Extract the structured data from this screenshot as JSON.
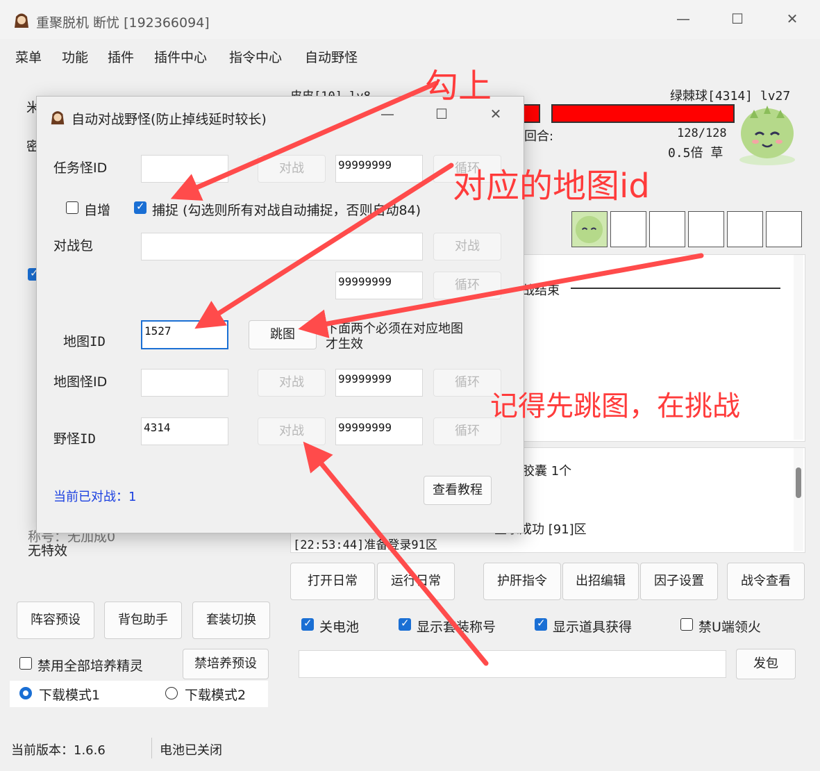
{
  "main": {
    "title": "重聚脱机 断忧 [192366094]",
    "menu": [
      "菜单",
      "功能",
      "插件",
      "插件中心",
      "指令中心",
      "自动野怪"
    ],
    "pet_left": "皮皮[10] lv8",
    "pet_right": "绿棘球[4314] lv27",
    "round_label": "回合:",
    "hp": "128/128",
    "mult": "0.5倍 草",
    "battle_end": "战结束",
    "log_line1": "胶囊 1个",
    "log_line2": "登录成功 [91]区",
    "log_line3": "[22:53:44]准备登录91区",
    "title_label": "称号：无加成0",
    "no_effect": "无特效",
    "left_frag1": "米",
    "left_frag2": "密",
    "buttons_right": [
      "打开日常",
      "运行日常",
      "护肝指令",
      "出招编辑",
      "因子设置",
      "战令查看"
    ],
    "buttons_left": [
      "阵容预设",
      "背包助手",
      "套装切换"
    ],
    "checks_right": [
      "关电池",
      "显示套装称号",
      "显示道具获得",
      "禁U端领火"
    ],
    "disable_train": "禁用全部培养精灵",
    "train_preset": "禁培养预设",
    "download1": "下载模式1",
    "download2": "下载模式2",
    "send": "发包",
    "version": "当前版本：1.6.6",
    "battery_status": "电池已关闭"
  },
  "dialog": {
    "title": "自动对战野怪(防止掉线延时较长)",
    "task_label": "任务怪ID",
    "fight": "对战",
    "loop": "循环",
    "count": "99999999",
    "auto_inc": "自增",
    "capture": "捕捉 (勾选则所有对战自动捕捉，否则自动84)",
    "packet_label": "对战包",
    "map_label": "地图ID",
    "map_value": "1527",
    "jump": "跳图",
    "hint_line1": "下面两个必须在对应地图",
    "hint_line2": "才生效",
    "map_monster_label": "地图怪ID",
    "wild_label": "野怪ID",
    "wild_value": "4314",
    "fought": "当前已对战：1",
    "tutorial": "查看教程"
  },
  "annotations": {
    "check_it": "勾上",
    "map_id": "对应的地图id",
    "jump_first": "记得先跳图，在挑战"
  },
  "colors": {
    "accent": "#1a6fd4",
    "annotation": "#ff3b3b",
    "hp": "#ff0000"
  }
}
